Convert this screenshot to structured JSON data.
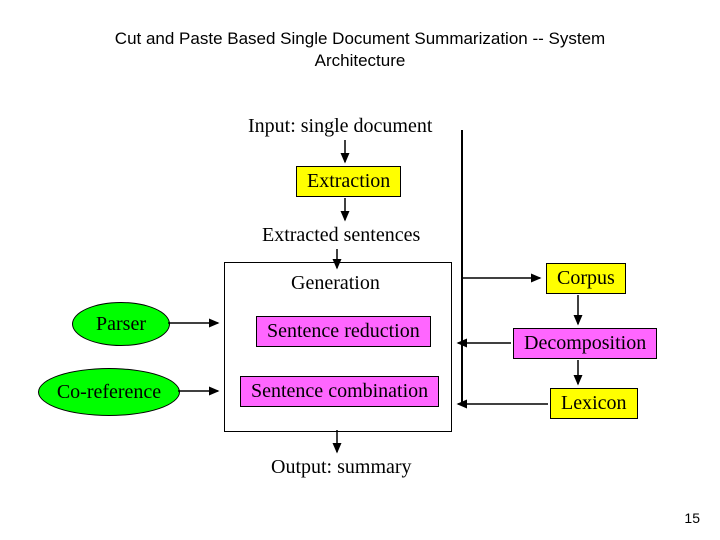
{
  "title_line1": "Cut and Paste Based Single Document Summarization  -- System",
  "title_line2": "Architecture",
  "input_label": "Input: single document",
  "extraction": "Extraction",
  "extracted": "Extracted sentences",
  "generation": "Generation",
  "sentence_reduction": "Sentence reduction",
  "sentence_combination": "Sentence combination",
  "output_label": "Output: summary",
  "parser": "Parser",
  "coreference": "Co-reference",
  "corpus": "Corpus",
  "decomposition": "Decomposition",
  "lexicon": "Lexicon",
  "page_number": "15"
}
